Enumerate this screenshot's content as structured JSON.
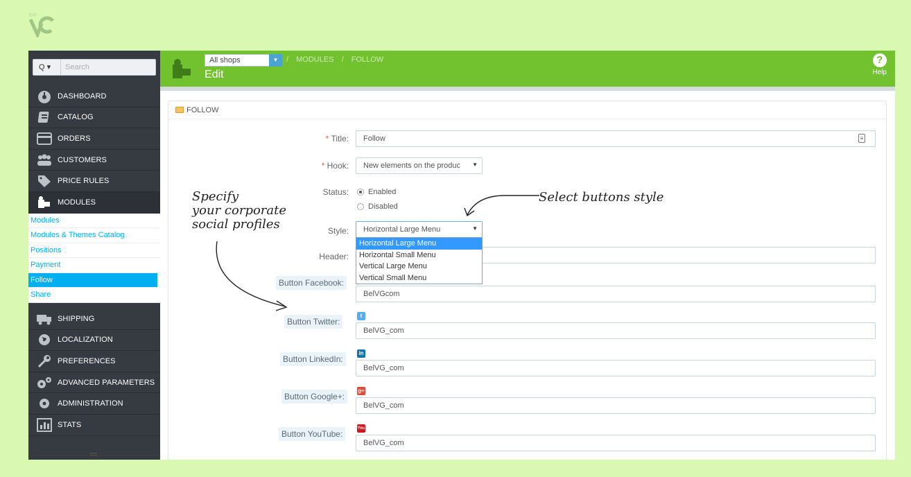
{
  "sidebar": {
    "search_button": "Q ▾",
    "search_placeholder": "Search",
    "menu": [
      {
        "label": "DASHBOARD",
        "icon": "dashboard-icon"
      },
      {
        "label": "CATALOG",
        "icon": "catalog-icon"
      },
      {
        "label": "ORDERS",
        "icon": "orders-icon"
      },
      {
        "label": "CUSTOMERS",
        "icon": "customers-icon"
      },
      {
        "label": "PRICE RULES",
        "icon": "price-rules-icon"
      },
      {
        "label": "MODULES",
        "icon": "modules-icon"
      }
    ],
    "submenu": [
      {
        "label": "Modules"
      },
      {
        "label": "Modules & Themes Catalog"
      },
      {
        "label": "Positions"
      },
      {
        "label": "Payment"
      },
      {
        "label": "Follow"
      },
      {
        "label": "Share"
      }
    ],
    "menu2": [
      {
        "label": "SHIPPING",
        "icon": "shipping-icon"
      },
      {
        "label": "LOCALIZATION",
        "icon": "localization-icon"
      },
      {
        "label": "PREFERENCES",
        "icon": "preferences-icon"
      },
      {
        "label": "ADVANCED PARAMETERS",
        "icon": "advanced-parameters-icon"
      },
      {
        "label": "ADMINISTRATION",
        "icon": "administration-icon"
      },
      {
        "label": "STATS",
        "icon": "stats-icon"
      }
    ]
  },
  "header": {
    "shop_select": "All shops",
    "breadcrumb": [
      "MODULES",
      "FOLLOW"
    ],
    "title": "Edit",
    "help_label": "Help",
    "help_glyph": "?"
  },
  "panel": {
    "heading": "FOLLOW",
    "title_label": "Title:",
    "title_value": "Follow",
    "hook_label": "Hook:",
    "hook_value": "New elements on the produc",
    "status_label": "Status:",
    "status_enabled": "Enabled",
    "status_disabled": "Disabled",
    "style_label": "Style:",
    "style_value": "Horizontal Large Menu",
    "style_options": [
      "Horizontal Large Menu",
      "Horizontal Small Menu",
      "Vertical Large Menu",
      "Vertical Small Menu"
    ],
    "header_label": "Header:",
    "buttons": [
      {
        "label": "Button Facebook:",
        "value": "BelVGcom",
        "icon_text": "f",
        "color": "#3b5998"
      },
      {
        "label": "Button Twitter:",
        "value": "BelVG_com",
        "icon_text": "t",
        "color": "#55acee"
      },
      {
        "label": "Button LinkedIn:",
        "value": "BelVG_com",
        "icon_text": "in",
        "color": "#0e76a8"
      },
      {
        "label": "Button Google+:",
        "value": "BelVG_com",
        "icon_text": "g+",
        "color": "#dd4b39"
      },
      {
        "label": "Button YouTube:",
        "value": "BelVG_com",
        "icon_text": "You",
        "color": "#cc181e"
      }
    ]
  },
  "annotations": {
    "left_line1": "Specify",
    "left_line2": "your corporate",
    "left_line3": "social profiles",
    "right": "Select buttons style"
  },
  "colors": {
    "page_bg": "#d9f8b1",
    "header_green": "#72c12f",
    "sidebar_dark": "#363a41",
    "accent_blue": "#00aff0"
  }
}
